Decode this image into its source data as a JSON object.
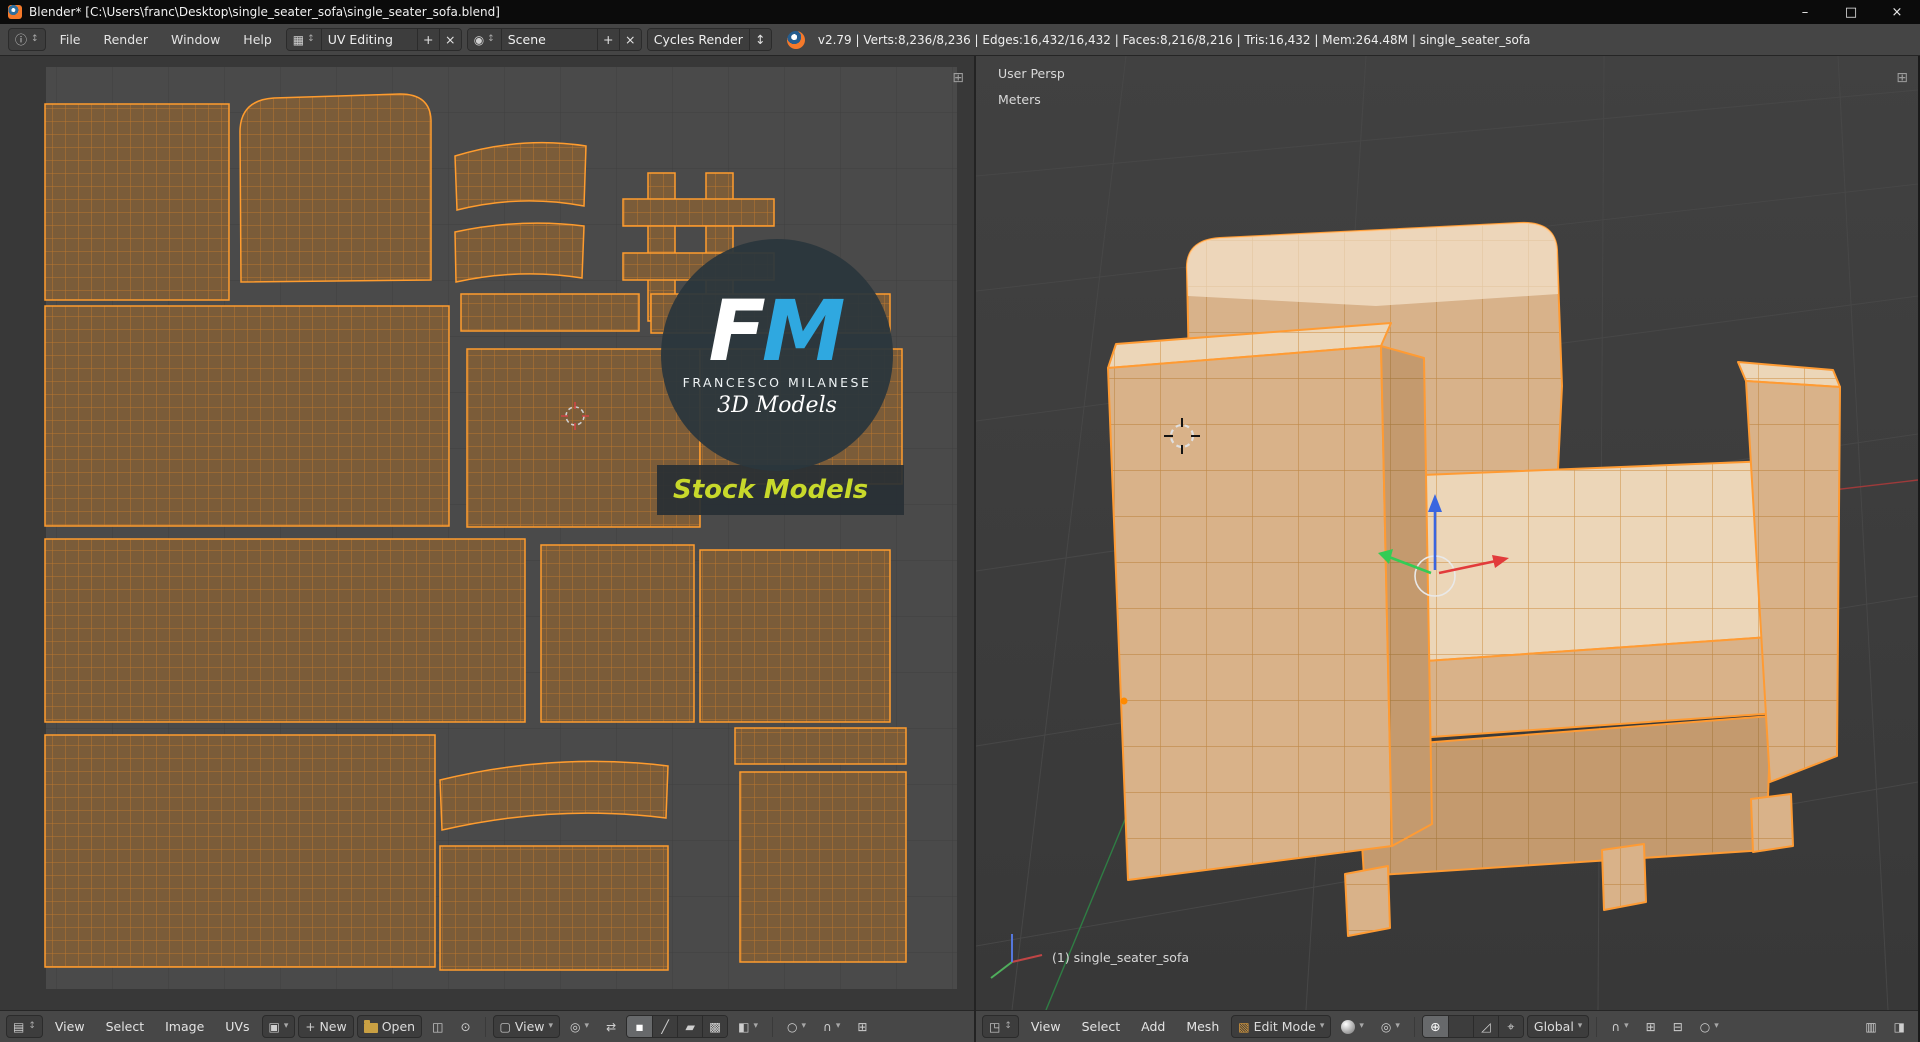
{
  "titlebar": {
    "title": "Blender* [C:\\Users\\franc\\Desktop\\single_seater_sofa\\single_seater_sofa.blend]",
    "minimize": "–",
    "maximize": "□",
    "close": "×"
  },
  "info_header": {
    "menus": [
      "File",
      "Render",
      "Window",
      "Help"
    ],
    "layout": "UV Editing",
    "scene": "Scene",
    "engine": "Cycles Render",
    "stats": "v2.79 | Verts:8,236/8,236 | Edges:16,432/16,432 | Faces:8,216/8,216 | Tris:16,432 | Mem:264.48M | single_seater_sofa"
  },
  "uv_editor": {
    "header": {
      "menus": [
        "View",
        "Select",
        "Image",
        "UVs"
      ],
      "new": "New",
      "open": "Open",
      "display": "View"
    },
    "logo": {
      "initial_f": "F",
      "initial_m": "M",
      "name": "FRANCESCO MILANESE",
      "tagline": "3D Models",
      "banner": "Stock Models"
    }
  },
  "viewport": {
    "view_name": "User Persp",
    "units": "Meters",
    "object_info": "(1) single_seater_sofa",
    "header": {
      "menus": [
        "View",
        "Select",
        "Add",
        "Mesh"
      ],
      "mode": "Edit Mode",
      "orientation": "Global"
    }
  },
  "icons": {
    "info": "ⓘ",
    "updown": "↕",
    "down": "▾",
    "plus": "+",
    "close": "×",
    "layout": "▦",
    "scene": "◉",
    "image_editor": "▤",
    "view3d_editor": "◳",
    "image": "▣",
    "external": "◫",
    "pin": "⊙",
    "display": "▢",
    "pivot": "◎",
    "sync": "⇄",
    "sel_vertex": "▪",
    "sel_edge": "╱",
    "sel_face": "▰",
    "sel_island": "▩",
    "sticky": "◧",
    "proportional": "○",
    "magnet": "∩",
    "snap_grid": "⊞",
    "cube": "▧",
    "translate": "⊕",
    "rotate": "↻",
    "scale": "◿",
    "axis": "⌖",
    "layers": "⊟",
    "render_a": "▥",
    "render_b": "◨",
    "panel_plus": "⊞"
  },
  "colors": {
    "selection_orange": "#ff9c2e",
    "uv_fill_brown": "#7b5c39",
    "sofa_tan": "#d9b289",
    "logo_blue": "#2fa8e0",
    "banner_yellow": "#c8d92b",
    "axis_x_red": "#e23b3b",
    "axis_y_green": "#33cc55",
    "axis_z_blue": "#3a66e0"
  }
}
